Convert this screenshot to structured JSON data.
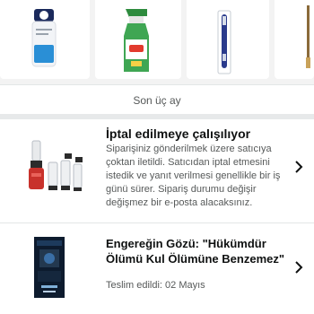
{
  "recent_products": [
    {
      "icon": "lotion-bottle-icon"
    },
    {
      "icon": "spray-cleaner-icon"
    },
    {
      "icon": "toothbrush-icon"
    },
    {
      "icon": "brush-icon"
    }
  ],
  "section": {
    "title": "Son üç ay"
  },
  "orders": [
    {
      "status_title": "İptal edilmeye çalışılıyor",
      "description": "Siparişiniz gönderilmek üzere satıcıya çoktan iletildi. Satıcıdan iptal etmesini istedik ve yanıt verilmesi genellikle bir iş günü sürer. Sipariş durumu değişir değişmez bir e-posta alacaksınız.",
      "image": "blender-set-icon"
    },
    {
      "product_title": "Engereğin Gözü: \"Hükümdür Ölümü Kul Ölümüne Benzemez\"",
      "delivery_status": "Teslim edildi: 02 Mayıs",
      "image": "book-cover-icon"
    }
  ],
  "colors": {
    "strip_bg": "#f3f3f3",
    "band": "#e7e9ea",
    "text_primary": "#0f1111",
    "text_secondary": "#565959"
  }
}
